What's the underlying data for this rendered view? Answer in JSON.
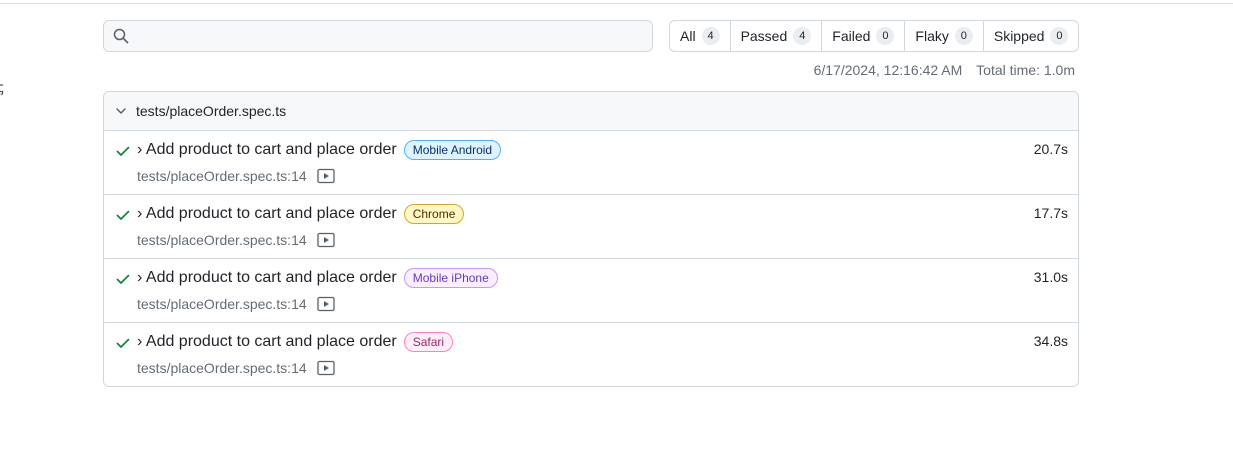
{
  "search": {
    "value": "",
    "placeholder": ""
  },
  "filters": [
    {
      "label": "All",
      "count": "4"
    },
    {
      "label": "Passed",
      "count": "4"
    },
    {
      "label": "Failed",
      "count": "0"
    },
    {
      "label": "Flaky",
      "count": "0"
    },
    {
      "label": "Skipped",
      "count": "0"
    }
  ],
  "meta": {
    "timestamp": "6/17/2024, 12:16:42 AM",
    "total_time": "Total time: 1.0m"
  },
  "suite": {
    "file": "tests/placeOrder.spec.ts",
    "tests": [
      {
        "title": "› Add product to cart and place order",
        "project": "Mobile Android",
        "location": "tests/placeOrder.spec.ts:14",
        "duration": "20.7s"
      },
      {
        "title": "› Add product to cart and place order",
        "project": "Chrome",
        "location": "tests/placeOrder.spec.ts:14",
        "duration": "17.7s"
      },
      {
        "title": "› Add product to cart and place order",
        "project": "Mobile iPhone",
        "location": "tests/placeOrder.spec.ts:14",
        "duration": "31.0s"
      },
      {
        "title": "› Add product to cart and place order",
        "project": "Safari",
        "location": "tests/placeOrder.spec.ts:14",
        "duration": "34.8s"
      }
    ]
  },
  "icons": {
    "search": "search-icon",
    "chevron": "chevron-down-icon",
    "status": "check-icon",
    "video": "video-icon"
  },
  "colors": {
    "pass_check": "#1a7f37",
    "tag_mobile_android_bg": "#ddf4ff",
    "tag_mobile_android_border": "#54aeff",
    "tag_mobile_android_text": "#0a3069",
    "tag_chrome_bg": "#fff8c5",
    "tag_chrome_border": "#d4a72c",
    "tag_chrome_text": "#4d2d00",
    "tag_mobile_iphone_bg": "#fbefff",
    "tag_mobile_iphone_border": "#c297ff",
    "tag_mobile_iphone_text": "#6639ba",
    "tag_safari_bg": "#ffeff7",
    "tag_safari_border": "#ff80c8",
    "tag_safari_text": "#99286e"
  }
}
